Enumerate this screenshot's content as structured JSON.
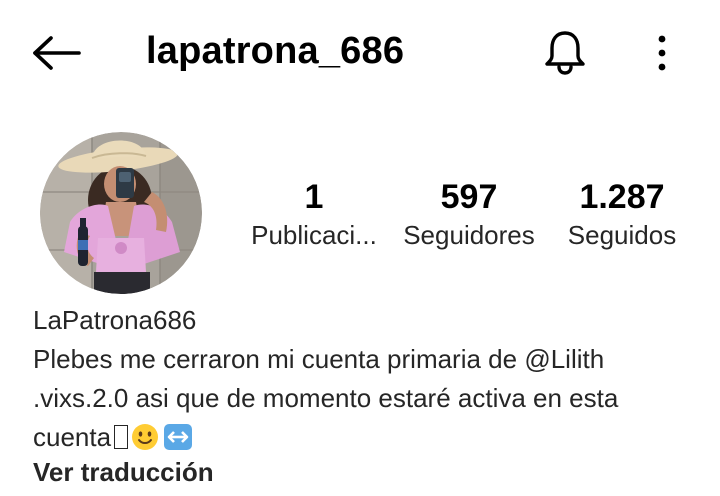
{
  "header": {
    "username": "lapatrona_686",
    "back_icon": "arrow-left-icon",
    "notifications_icon": "bell-icon",
    "more_icon": "more-vertical-icon"
  },
  "profile": {
    "avatar": "profile-photo",
    "stats": {
      "posts_count": "1",
      "posts_label": "Publicaci...",
      "followers_count": "597",
      "followers_label": "Seguidores",
      "following_count": "1.287",
      "following_label": "Seguidos"
    },
    "display_name": "LaPatrona686",
    "bio": {
      "line1": "Plebes me cerraron mi cuenta primaria de @Lilith",
      "line2": ".vixs.2.0 asi que de momento estaré activa en esta",
      "line3_text": "cuenta",
      "emojis": [
        "unsupported-glyph-box",
        "slightly-smiling-face-emoji",
        "left-right-arrow-emoji"
      ]
    },
    "translate_label": "Ver traducción"
  },
  "colors": {
    "text": "#262626",
    "emoji_yellow": "#FFCC33",
    "emoji_blue": "#5AA8E6",
    "hat": "#E9D9B8",
    "blouse": "#E3A6DA"
  }
}
